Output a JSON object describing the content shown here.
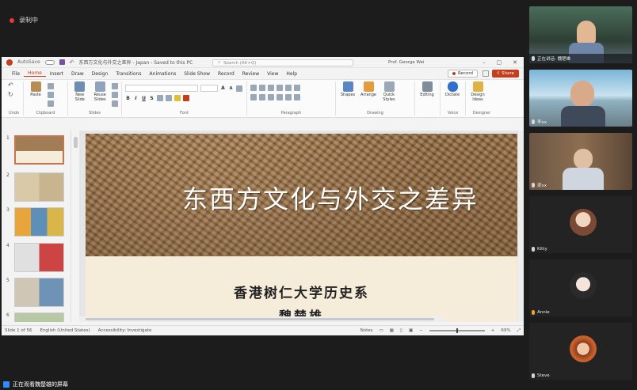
{
  "meeting": {
    "recording_label": "录制中",
    "speaker_banner": "正在讲话: 魏楚雄"
  },
  "ppt": {
    "autosave_label": "AutoSave",
    "autosave_state": "Off",
    "doc_title": "东西方文化与外交之差异 - Japan - Saved to this PC",
    "search_placeholder": "Search (Alt+Q)",
    "user_name": "Prof. George Wei",
    "tabs": [
      "File",
      "Home",
      "Insert",
      "Draw",
      "Design",
      "Transitions",
      "Animations",
      "Slide Show",
      "Record",
      "Review",
      "View",
      "Help"
    ],
    "active_tab": "Home",
    "record_label": "Record",
    "share_label": "Share",
    "ribbon": {
      "undo_label": "Undo",
      "paste_label": "Paste",
      "clipboard_label": "Clipboard",
      "new_slide_label": "New Slide",
      "reuse_slides_label": "Reuse Slides",
      "slides_label": "Slides",
      "font_label": "Font",
      "paragraph_label": "Paragraph",
      "shapes_label": "Shapes",
      "arrange_label": "Arrange",
      "quick_styles_label": "Quick Styles",
      "drawing_label": "Drawing",
      "editing_label": "Editing",
      "dictate_label": "Dictate",
      "voice_label": "Voice",
      "design_ideas_label": "Design Ideas",
      "designer_label": "Designer",
      "font_size_a_up": "A",
      "font_size_a_down": "A",
      "bold": "B",
      "italic": "I",
      "underline": "U",
      "strike": "S"
    },
    "slide_numbers": [
      "1",
      "2",
      "3",
      "4",
      "5",
      "6"
    ],
    "slide": {
      "title": "东西方文化与外交之差异",
      "subtitle": "香港树仁大学历史系",
      "author": "魏楚雄"
    },
    "status": {
      "slide_count": "Slide 1 of 56",
      "language": "English (United States)",
      "accessibility": "Accessibility: Investigate",
      "notes_label": "Notes",
      "zoom": "69%"
    }
  },
  "participants": [
    {
      "name": "正在讲话: 魏楚雄",
      "kind": "video"
    },
    {
      "name": "李xx",
      "kind": "video"
    },
    {
      "name": "梁xx",
      "kind": "video"
    },
    {
      "name": "Kitty",
      "kind": "avatar"
    },
    {
      "name": "Annie",
      "kind": "avatar"
    },
    {
      "name": "Steve",
      "kind": "avatar"
    }
  ],
  "bottom": {
    "label": "正在观看魏楚雄的屏幕"
  },
  "colors": {
    "accent": "#c43e1c",
    "meeting_bg": "#1c1c1c",
    "slide_bottom": "#f5ecd9"
  }
}
